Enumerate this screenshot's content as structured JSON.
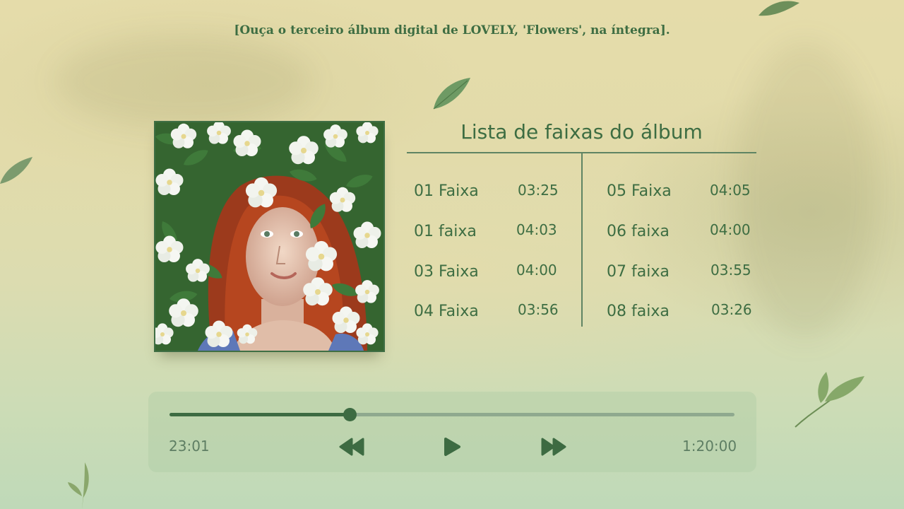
{
  "headline": "[Ouça o terceiro álbum digital de LOVELY, 'Flowers', na íntegra].",
  "album": {
    "cover_alt": "Capa do álbum Flowers",
    "tracklist_title": "Lista de faixas do álbum"
  },
  "tracks_left": [
    {
      "name": "01 Faixa",
      "duration": "03:25"
    },
    {
      "name": "01 faixa",
      "duration": "04:03"
    },
    {
      "name": "03 Faixa",
      "duration": "04:00"
    },
    {
      "name": "04 Faixa",
      "duration": "03:56"
    }
  ],
  "tracks_right": [
    {
      "name": "05 Faixa",
      "duration": "04:05"
    },
    {
      "name": "06 faixa",
      "duration": "04:00"
    },
    {
      "name": "07 faixa",
      "duration": "03:55"
    },
    {
      "name": "08 faixa",
      "duration": "03:26"
    }
  ],
  "player": {
    "current_time": "23:01",
    "total_time": "1:20:00",
    "progress": 0.32,
    "controls": {
      "rewind": "rewind-icon",
      "play": "play-icon",
      "forward": "fast-forward-icon"
    }
  },
  "colors": {
    "accent": "#3d6d42",
    "track_line": "#5f8463",
    "progress_bg": "#8fa98f"
  }
}
